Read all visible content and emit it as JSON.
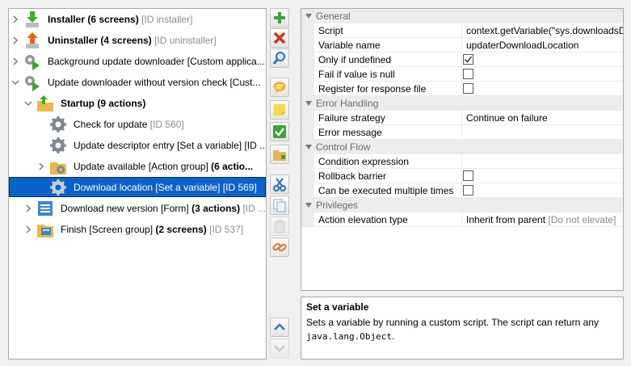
{
  "tree": {
    "items": [
      {
        "name": "installer",
        "bold": "Installer (6 screens)",
        "text": "",
        "tag": "[ID installer]",
        "icon": "installer-icon"
      },
      {
        "name": "uninstaller",
        "bold": "Uninstaller (4 screens)",
        "text": "",
        "tag": "[ID uninstaller]",
        "icon": "uninstaller-icon"
      },
      {
        "name": "background-updater",
        "bold": "",
        "text": "Background update downloader [Custom applica...",
        "tag": "",
        "icon": "gear-launcher-icon"
      },
      {
        "name": "update-downloader",
        "bold": "",
        "text": "Update downloader without version check [Cust...",
        "tag": "",
        "icon": "gear-launcher-icon"
      },
      {
        "name": "startup",
        "bold": "Startup (9 actions)",
        "text": "",
        "tag": "",
        "icon": "startup-folder-icon"
      },
      {
        "name": "check-for-update",
        "bold": "",
        "text": "Check for update",
        "tag": "[ID 560]",
        "icon": "gear-icon"
      },
      {
        "name": "update-descriptor-entry",
        "bold": "",
        "text": "Update descriptor entry [Set a variable] [ID ...",
        "tag": "",
        "icon": "gear-icon"
      },
      {
        "name": "update-available",
        "bold_after": "(6 actio...",
        "text": "Update available [Action group] ",
        "tag": "",
        "icon": "gear-folder-icon"
      },
      {
        "name": "download-location",
        "bold": "",
        "text": "Download location [Set a variable] [ID 569]",
        "tag": "",
        "icon": "gear-icon"
      },
      {
        "name": "download-new-version",
        "bold_after": "(3 actions)",
        "text": "Download new version [Form] ",
        "tag": "[ID ...",
        "icon": "form-icon"
      },
      {
        "name": "finish",
        "bold_after": "(2 screens)",
        "text": "Finish [Screen group] ",
        "tag": "[ID 537]",
        "icon": "screen-group-icon"
      }
    ]
  },
  "toolbar": {
    "add": "add-icon",
    "delete": "delete-icon",
    "search": "search-icon",
    "comment": "comment-icon",
    "note": "note-icon",
    "check": "check-icon",
    "folder": "add-folder-icon",
    "cut": "cut-icon",
    "copy": "copy-icon",
    "paste": "paste-icon",
    "link": "link-icon",
    "up": "arrow-up-icon",
    "down": "arrow-down-icon"
  },
  "properties": {
    "general": {
      "title": "General",
      "script_label": "Script",
      "script_value": "context.getVariable(\"sys.downloadsD",
      "varname_label": "Variable name",
      "varname_value": "updaterDownloadLocation",
      "only_if_undefined_label": "Only if undefined",
      "only_if_undefined_checked": true,
      "fail_if_null_label": "Fail if value is null",
      "fail_if_null_checked": false,
      "register_label": "Register for response file",
      "register_checked": false
    },
    "error_handling": {
      "title": "Error Handling",
      "failure_strategy_label": "Failure strategy",
      "failure_strategy_value": "Continue on failure",
      "error_message_label": "Error message",
      "error_message_value": ""
    },
    "control_flow": {
      "title": "Control Flow",
      "condition_label": "Condition expression",
      "condition_value": "",
      "rollback_label": "Rollback barrier",
      "rollback_checked": false,
      "multiple_label": "Can be executed multiple times",
      "multiple_checked": false
    },
    "privileges": {
      "title": "Privileges",
      "elevation_label": "Action elevation type",
      "elevation_value": "Inherit from parent ",
      "elevation_tag": "[Do not elevate]"
    }
  },
  "description": {
    "title": "Set a variable",
    "text": "Sets a variable by running a custom script. The script can return any",
    "code": "java.lang.Object",
    "end": "."
  }
}
